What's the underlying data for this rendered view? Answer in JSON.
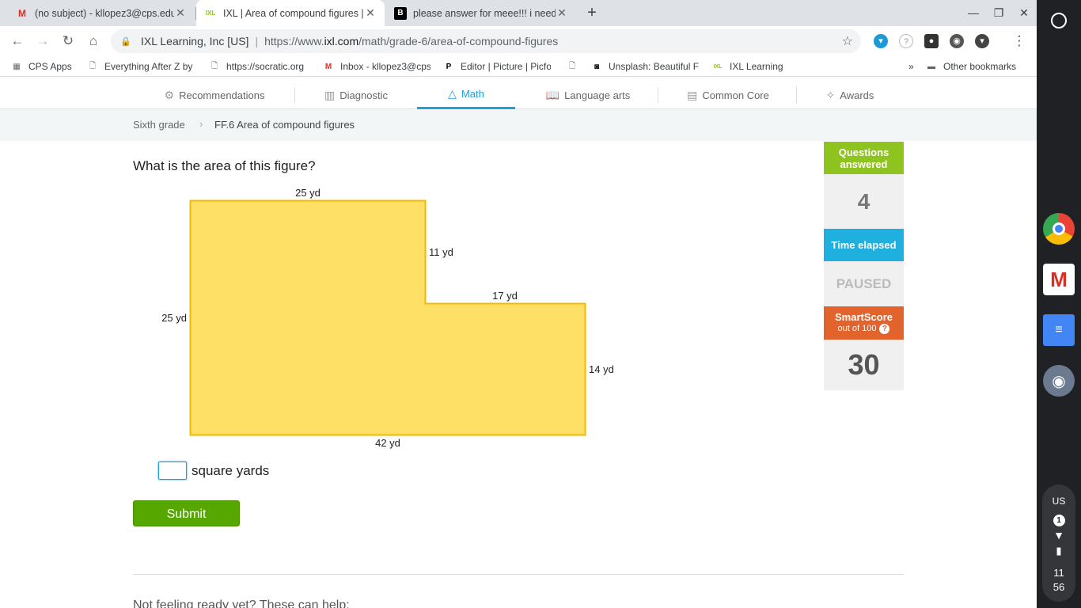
{
  "browser": {
    "tabs": [
      {
        "title": "(no subject) - kllopez3@cps.edu",
        "favicon": "M",
        "favicon_color": "#d93025",
        "active": false
      },
      {
        "title": "IXL | Area of compound figures |",
        "favicon": "IXL",
        "favicon_color": "#8fc31f",
        "active": true
      },
      {
        "title": "please answer for meee!!! i need",
        "favicon": "B",
        "favicon_color": "#000000",
        "active": false
      }
    ],
    "omnibox": {
      "org": "IXL Learning, Inc [US]",
      "url_prefix": "https://www.",
      "url_domain": "ixl.com",
      "url_path": "/math/grade-6/area-of-compound-figures"
    },
    "bookmarks": [
      {
        "label": "CPS Apps",
        "icon": "grid-icon"
      },
      {
        "label": "Everything After Z by",
        "icon": "page-icon"
      },
      {
        "label": "https://socratic.org",
        "icon": "page-icon"
      },
      {
        "label": "Inbox - kllopez3@cps",
        "icon": "gmail-icon"
      },
      {
        "label": "Editor | Picture | Picfo",
        "icon": "picfont-icon"
      },
      {
        "label": "",
        "icon": "page-icon"
      },
      {
        "label": "Unsplash: Beautiful F",
        "icon": "camera-icon"
      },
      {
        "label": "IXL Learning",
        "icon": "ixl-icon"
      }
    ],
    "other_bookmarks": "Other bookmarks",
    "overflow": "»"
  },
  "subnav": [
    {
      "label": "Recommendations",
      "icon": "recommendations-icon",
      "active": false
    },
    {
      "label": "Diagnostic",
      "icon": "diagnostic-icon",
      "active": false
    },
    {
      "label": "Math",
      "icon": "math-icon",
      "active": true
    },
    {
      "label": "Language arts",
      "icon": "book-icon",
      "active": false
    },
    {
      "label": "Common Core",
      "icon": "core-icon",
      "active": false
    },
    {
      "label": "Awards",
      "icon": "awards-icon",
      "active": false
    }
  ],
  "breadcrumb": {
    "grade": "Sixth grade",
    "skill": "FF.6 Area of compound figures"
  },
  "question": {
    "prompt": "What is the area of this figure?",
    "labels": {
      "top": "25 yd",
      "right_upper": "11 yd",
      "step": "17 yd",
      "left": "25 yd",
      "right_lower": "14 yd",
      "bottom": "42 yd"
    },
    "fill_color": "#ffe066",
    "stroke_color": "#f5b800",
    "answer_value": "",
    "unit": "square yards",
    "submit_label": "Submit"
  },
  "stats": {
    "questions_answered_label": "Questions answered",
    "questions_answered": "4",
    "time_elapsed_label": "Time elapsed",
    "time_elapsed": "PAUSED",
    "smartscore_label": "SmartScore",
    "smartscore_sub": "out of 100",
    "smartscore_help": "?",
    "smartscore": "30"
  },
  "footer_text": "Not feeling ready yet? These can help:",
  "shelf": {
    "tray_lang": "US",
    "tray_badge": "1",
    "clock_hour": "11",
    "clock_min": "56"
  }
}
